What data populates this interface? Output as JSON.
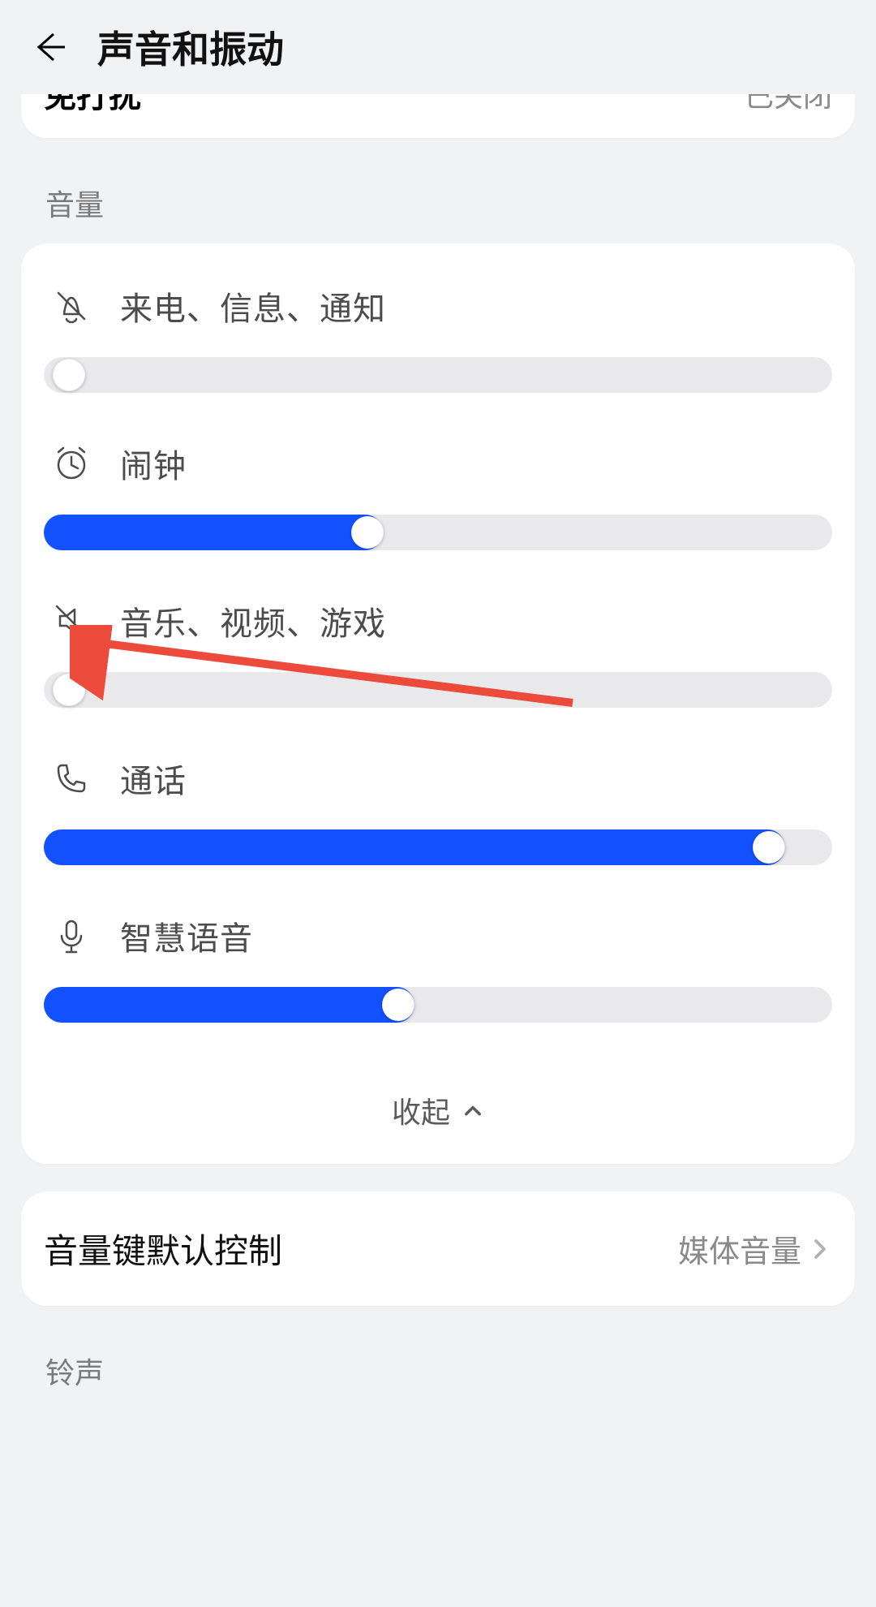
{
  "header": {
    "title": "声音和振动"
  },
  "peek": {
    "left": "免打扰",
    "right": "已关闭"
  },
  "sections": {
    "volume_label": "音量",
    "ringtone_label": "铃声"
  },
  "sliders": {
    "ring": {
      "label": "来电、信息、通知",
      "value": 0
    },
    "alarm": {
      "label": "闹钟",
      "value": 41
    },
    "media": {
      "label": "音乐、视频、游戏",
      "value": 0
    },
    "call": {
      "label": "通话",
      "value": 92
    },
    "voice": {
      "label": "智慧语音",
      "value": 45
    }
  },
  "collapse": {
    "label": "收起"
  },
  "vol_key_control": {
    "title": "音量键默认控制",
    "value": "媒体音量"
  },
  "colors": {
    "accent": "#1351ff",
    "track": "#e9e9ec"
  }
}
